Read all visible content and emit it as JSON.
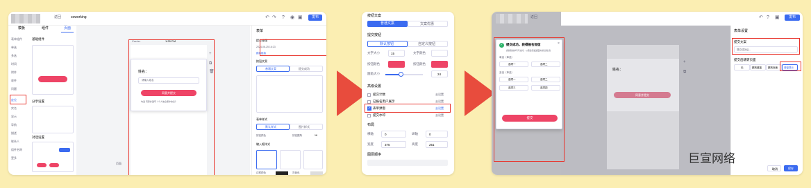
{
  "panel1": {
    "back": "返回",
    "title": "coworking",
    "publish": "发布",
    "tabs": [
      "模板",
      "组件",
      "页面"
    ],
    "side": [
      "表单组件",
      "单选",
      "多选",
      "时间",
      "附件",
      "收件",
      "问题",
      "定位",
      "实名",
      "显示",
      "导航",
      "描述",
      "联系人",
      "组件名称",
      "更多"
    ],
    "left_groups": [
      "基础组件",
      "分享设置",
      "对话设置"
    ],
    "phone_time": "1:25 PM",
    "phone_carrier": "Carrier",
    "form_label": "姓名：",
    "form_input_ph": "请输入姓名",
    "submit": "同意并提交",
    "agree": "勾选 同意并遵守《个人信息保护协议》",
    "page_label": "页面",
    "right_title": "表单",
    "r1": "提交按钮",
    "r1_date": "2024-06-25 16:23",
    "r1_link": "跳转链接",
    "r2": "按钮文案",
    "r2_tabs": [
      "普通文案",
      "提交成功"
    ],
    "r3": "表单样式",
    "r3_tabs": [
      "默认样式",
      "图片样式"
    ],
    "r3_a": "按钮颜色",
    "r3_b": "按钮圆角",
    "r3_b_val": "16",
    "r4": "输入框样式",
    "r4_a": "圆角",
    "r4_b": "边框颜色",
    "r4_c": "背景色"
  },
  "panel2": {
    "title": "按钮文案",
    "tabs": [
      "普通文案",
      "文案优惠"
    ],
    "sec1": "提交按钮",
    "sub_tabs": [
      "默认按钮",
      "自定义按钮"
    ],
    "size_label": "文字大小",
    "size_val": "15",
    "color_label": "文字颜色",
    "bg_label": "按钮颜色",
    "border_label": "按钮颜色",
    "radius_label": "圆角大小",
    "radius_val": "24",
    "sec2": "高级设置",
    "opts": [
      "提交计数",
      "已报名用户展示",
      "表单弹窗",
      "提交水印"
    ],
    "opt_right": "去设置",
    "sec3": "布局",
    "w_label": "横轴",
    "w_val": "0",
    "h_label": "纵轴",
    "h_val": "0",
    "wd_label": "宽度",
    "wd_val": "375",
    "ht_label": "高度",
    "ht_val": "251",
    "sec4": "图层顺序"
  },
  "panel3": {
    "back": "返回",
    "publish": "发布",
    "popup_title": "提交成功，获得报名短信",
    "popup_sub": "感谢您的参与与支持，以便给您发送更多的优惠信息",
    "q1": "单选（单选）",
    "q2": "多选（单选）",
    "opts": [
      "选项一",
      "选项二",
      "选项三",
      "选项四"
    ],
    "popup_btn": "提交",
    "right_back": "表单设置",
    "r1": "提交文案",
    "r1_ph": "提交成功后...",
    "r2": "提交后跳转页面",
    "r2_opts": [
      "无",
      "跳转链接",
      "跳转页面",
      "弹窗提示"
    ],
    "phone_label": "姓名：",
    "phone_submit": "同意并提交",
    "footer_a": "取消",
    "footer_b": "保存",
    "watermark": "巨宣网络"
  },
  "colors": {
    "accent": "#3b6bf0",
    "pink": "#ee4466",
    "highlight": "#e8342c",
    "bg": "#fbeeb2",
    "arrow": "#e84c3d"
  }
}
